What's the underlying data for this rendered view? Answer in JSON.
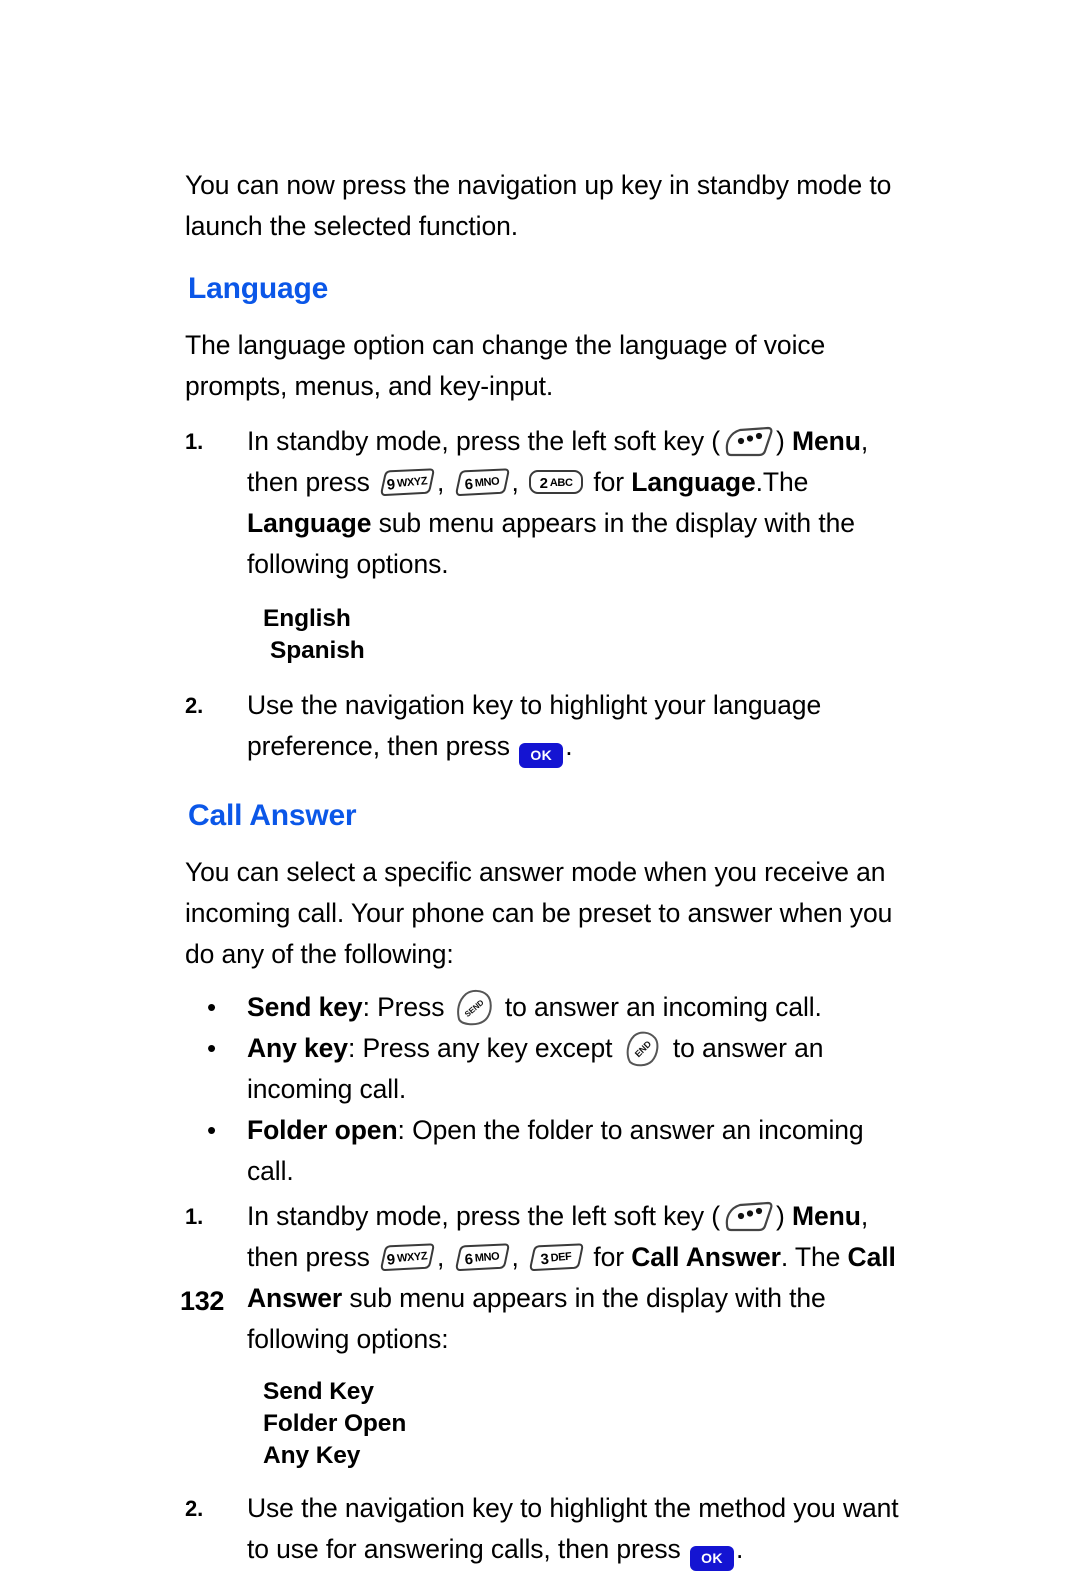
{
  "page": {
    "number": "132"
  },
  "intro": {
    "text": "You can now press the navigation up key in standby mode to launch the selected function."
  },
  "language_section": {
    "heading": "Language",
    "intro": "The language option can change the language of voice prompts, menus, and key-input.",
    "step1": {
      "number": "1.",
      "part1": "In standby mode, press the left soft key (",
      "part2": ") ",
      "menu_label": "Menu",
      "part3": ", then press ",
      "comma1": ", ",
      "comma2": ", ",
      "part4": " for ",
      "bold1": "Language",
      "part5": ".The ",
      "bold2": "Language",
      "part6": " sub menu appears in the display with the following options."
    },
    "options": [
      "English",
      "Spanish"
    ],
    "step2": {
      "number": "2.",
      "part1": "Use the navigation key to highlight your language preference, then press ",
      "part2": "."
    }
  },
  "call_answer_section": {
    "heading": "Call Answer",
    "intro": "You can select a specific answer mode when you receive an incoming call. Your phone can be preset to answer when you do any of the following:",
    "bullets": [
      {
        "dot": "•",
        "bold": "Send key",
        "part1": ": Press ",
        "part2": " to answer an incoming call."
      },
      {
        "dot": "•",
        "bold": "Any key",
        "part1": ": Press any key except ",
        "part2": " to answer an incoming call."
      },
      {
        "dot": "•",
        "bold": "Folder open",
        "part1": ": Open the folder to answer an incoming call.",
        "part2": ""
      }
    ],
    "step1": {
      "number": "1.",
      "part1": "In standby mode, press the left soft key (",
      "part2": ") ",
      "menu_label": "Menu",
      "part3": ", then press ",
      "comma1": ", ",
      "comma2": ", ",
      "part4": " for ",
      "bold1": "Call Answer",
      "part5": ". The ",
      "bold2": "Call Answer",
      "part6": " sub menu appears in the display with the following options:"
    },
    "options": [
      "Send Key",
      "Folder Open",
      "Any Key"
    ],
    "step2": {
      "number": "2.",
      "part1": "Use the navigation key to highlight the method you want to use for answering calls, then press ",
      "part2": "."
    }
  },
  "keys": {
    "nine": {
      "digit": "9",
      "letters": "WXYZ"
    },
    "six": {
      "digit": "6",
      "letters": "MNO"
    },
    "two": {
      "digit": "2",
      "letters": "ABC"
    },
    "three": {
      "digit": "3",
      "letters": "DEF"
    },
    "send_label": "SEND",
    "end_label": "END",
    "ok_label": "OK"
  },
  "colors": {
    "heading_blue": "#0B57E8",
    "ok_key_blue": "#1414D2",
    "text_black": "#000000",
    "page_background": "#FFFFFF"
  }
}
